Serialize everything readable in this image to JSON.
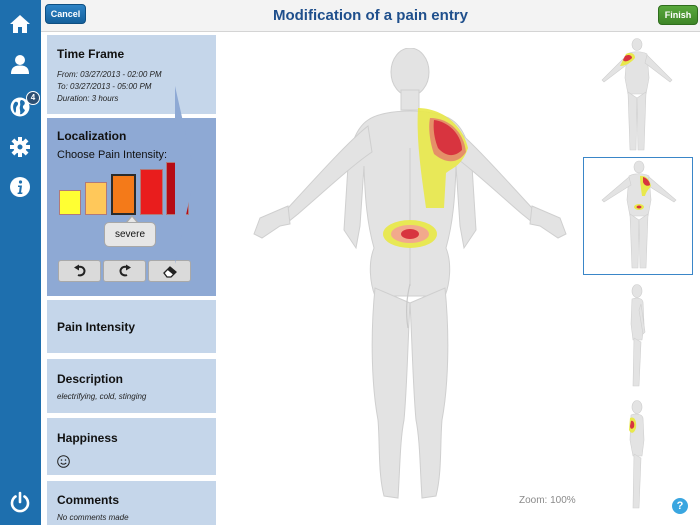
{
  "header": {
    "title": "Modification of a pain entry",
    "cancel_label": "Cancel",
    "finish_label": "Finish"
  },
  "nav": {
    "items": [
      {
        "icon": "home-icon"
      },
      {
        "icon": "user-icon"
      },
      {
        "icon": "globe-icon",
        "badge": "4"
      },
      {
        "icon": "gear-icon"
      },
      {
        "icon": "info-icon"
      },
      {
        "icon": "power-icon"
      }
    ]
  },
  "time_frame": {
    "title": "Time Frame",
    "from": "From: 03/27/2013 - 02:00 PM",
    "to": "To: 03/27/2013 - 05:00 PM",
    "duration": "Duration: 3 hours"
  },
  "localization": {
    "title": "Localization",
    "subtitle": "Choose Pain Intensity:",
    "levels": [
      {
        "color": "#ffff33"
      },
      {
        "color": "#ffc85a"
      },
      {
        "color": "#f47a19",
        "selected": true
      },
      {
        "color": "#e91d1d"
      },
      {
        "color": "#b60b14"
      }
    ],
    "selected_label": "severe",
    "tools": [
      "undo-icon",
      "redo-icon",
      "eraser-icon"
    ]
  },
  "pain_intensity": {
    "title": "Pain Intensity"
  },
  "description": {
    "title": "Description",
    "value": "electrifying, cold, stinging"
  },
  "happiness": {
    "title": "Happiness",
    "icon": "smile-icon"
  },
  "comments": {
    "title": "Comments",
    "value": "No comments made"
  },
  "viewer": {
    "zoom": "Zoom: 100%",
    "views": [
      "front-view",
      "back-view",
      "side-view",
      "side-view-2"
    ],
    "selected_view": "back-view",
    "help": "?"
  },
  "colors": {
    "nav": "#1e6fae",
    "card": "#c5d6ea",
    "card_active": "#8ea9d4",
    "title": "#1f4f8c"
  }
}
